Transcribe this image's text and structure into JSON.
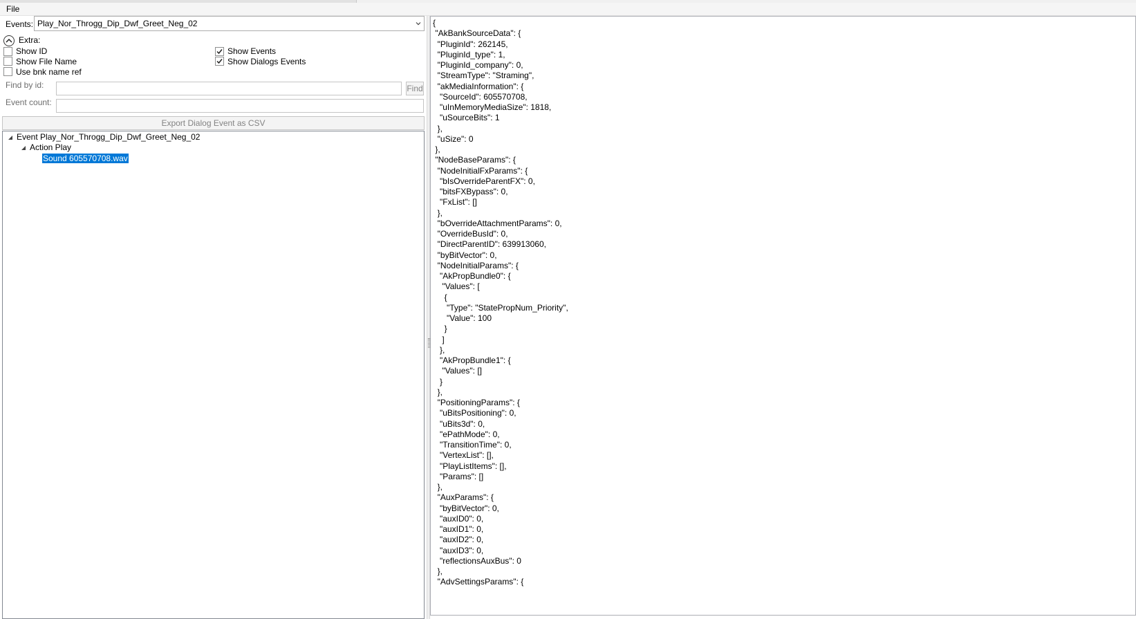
{
  "menu": {
    "file": "File"
  },
  "events_label": "Events:",
  "events_selected": "Play_Nor_Throgg_Dip_Dwf_Greet_Neg_02",
  "extra_label": "Extra:",
  "checkboxes": [
    {
      "label": "Show ID",
      "checked": false
    },
    {
      "label": "Show File Name",
      "checked": false
    },
    {
      "label": "Use bnk name ref",
      "checked": false
    },
    {
      "label": "Show Events",
      "checked": true
    },
    {
      "label": "Show Dialogs Events",
      "checked": true
    }
  ],
  "find_by_id_label": "Find by id:",
  "find_button": "Find",
  "event_count_label": "Event count:",
  "export_button": "Export Dialog Event as CSV",
  "tree": {
    "event": "Event Play_Nor_Throgg_Dip_Dwf_Greet_Neg_02",
    "action": "Action Play",
    "sound": "Sound 605570708.wav"
  },
  "json_lines": [
    "{",
    " \"AkBankSourceData\": {",
    "  \"PluginId\": 262145,",
    "  \"PluginId_type\": 1,",
    "  \"PluginId_company\": 0,",
    "  \"StreamType\": \"Straming\",",
    "  \"akMediaInformation\": {",
    "   \"SourceId\": 605570708,",
    "   \"uInMemoryMediaSize\": 1818,",
    "   \"uSourceBits\": 1",
    "  },",
    "  \"uSize\": 0",
    " },",
    " \"NodeBaseParams\": {",
    "  \"NodeInitialFxParams\": {",
    "   \"bIsOverrideParentFX\": 0,",
    "   \"bitsFXBypass\": 0,",
    "   \"FxList\": []",
    "  },",
    "  \"bOverrideAttachmentParams\": 0,",
    "  \"OverrideBusId\": 0,",
    "  \"DirectParentID\": 639913060,",
    "  \"byBitVector\": 0,",
    "  \"NodeInitialParams\": {",
    "   \"AkPropBundle0\": {",
    "    \"Values\": [",
    "     {",
    "      \"Type\": \"StatePropNum_Priority\",",
    "      \"Value\": 100",
    "     }",
    "    ]",
    "   },",
    "   \"AkPropBundle1\": {",
    "    \"Values\": []",
    "   }",
    "  },",
    "  \"PositioningParams\": {",
    "   \"uBitsPositioning\": 0,",
    "   \"uBits3d\": 0,",
    "   \"ePathMode\": 0,",
    "   \"TransitionTime\": 0,",
    "   \"VertexList\": [],",
    "   \"PlayListItems\": [],",
    "   \"Params\": []",
    "  },",
    "  \"AuxParams\": {",
    "   \"byBitVector\": 0,",
    "   \"auxID0\": 0,",
    "   \"auxID1\": 0,",
    "   \"auxID2\": 0,",
    "   \"auxID3\": 0,",
    "   \"reflectionsAuxBus\": 0",
    "  },",
    "  \"AdvSettingsParams\": {"
  ],
  "colors": {
    "selection": "#0078d7",
    "disabled_text": "#838383"
  }
}
